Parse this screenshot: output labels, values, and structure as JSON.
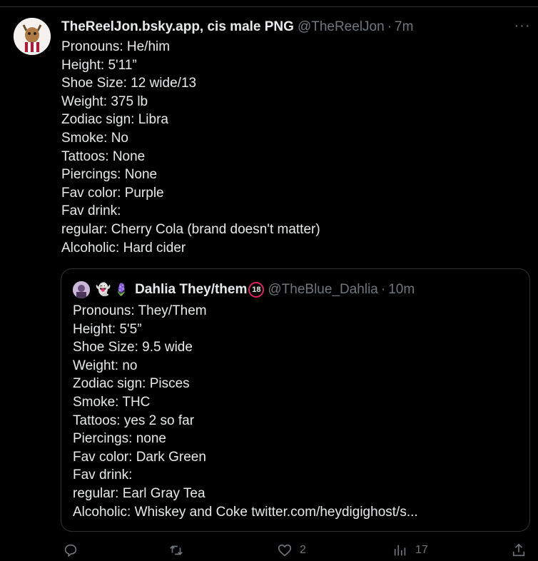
{
  "tweet": {
    "display_name": "TheReelJon.bsky.app, cis male PNG",
    "handle": "@TheReelJon",
    "separator": "·",
    "time": "7m",
    "more_label": "···",
    "lines": [
      "Pronouns: He/him",
      "Height: 5'11”",
      "Shoe Size: 12 wide/13",
      "Weight: 375 lb",
      "Zodiac sign: Libra",
      "Smoke: No",
      "Tattoos: None",
      "Piercings: None",
      "Fav color: Purple",
      "Fav drink:",
      "regular:  Cherry Cola (brand doesn't matter)",
      "Alcoholic: Hard cider"
    ]
  },
  "quote": {
    "emojis": "👻 🪻",
    "display_name": "Dahlia They/them",
    "badge": "18",
    "handle": "@TheBlue_Dahlia",
    "separator": "·",
    "time": "10m",
    "lines": [
      "Pronouns: They/Them",
      "Height: 5'5”",
      "Shoe Size: 9.5 wide",
      "Weight: no",
      "Zodiac sign: Pisces",
      "Smoke: THC",
      "Tattoos: yes 2 so far",
      "Piercings: none",
      "Fav color: Dark Green",
      "Fav drink:",
      "regular:  Earl Gray Tea",
      "Alcoholic: Whiskey and Coke twitter.com/heydigighost/s..."
    ]
  },
  "actions": {
    "reply_count": "",
    "retweet_count": "",
    "like_count": "2",
    "views_count": "17"
  },
  "colors": {
    "background": "#000000",
    "text": "#e7e9ea",
    "muted": "#71767b",
    "border": "#2f3336"
  }
}
